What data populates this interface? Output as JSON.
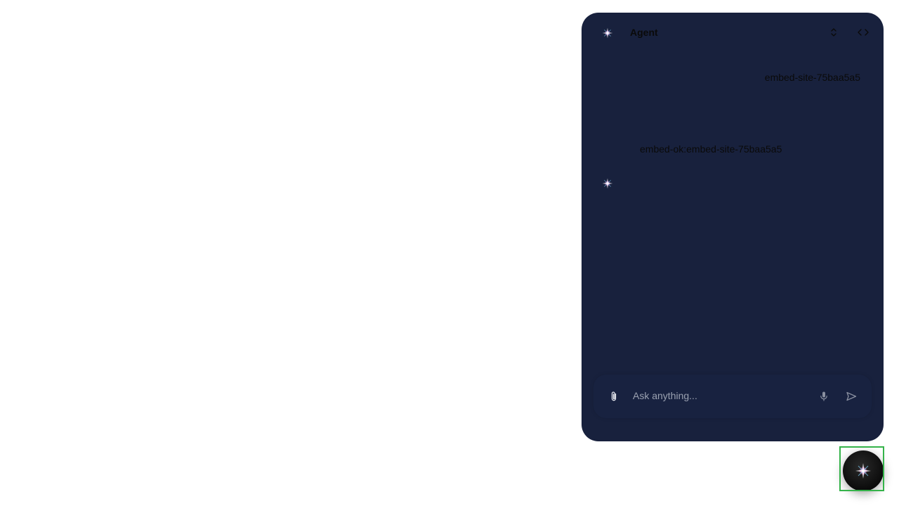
{
  "header": {
    "title": "Agent"
  },
  "messages": {
    "user": "embed-site-75baa5a5",
    "agent": "embed-ok:embed-site-75baa5a5"
  },
  "composer": {
    "placeholder": "Ask anything..."
  },
  "icons": {
    "header_logo": "sparkle-icon",
    "expand": "chevrons-up-down-icon",
    "code": "code-icon",
    "typing": "sparkle-icon",
    "attach": "paperclip-icon",
    "mic": "microphone-icon",
    "send": "send-icon",
    "launcher": "sparkle-icon"
  },
  "colors": {
    "panel_bg": "#18213d",
    "focus_ring": "#35b34a",
    "launcher_bg": "#0b0b0b"
  }
}
